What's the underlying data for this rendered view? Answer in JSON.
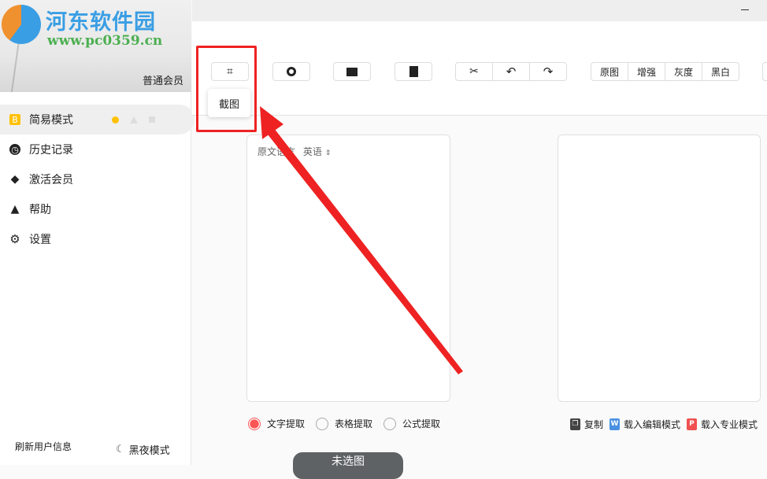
{
  "sidebar": {
    "logo_text": "河东软件园",
    "logo_url": "www.pc0359.cn",
    "member_level": "普通会员",
    "items": [
      {
        "label": "简易模式",
        "icon": "b-icon"
      },
      {
        "label": "历史记录",
        "icon": "clock-icon"
      },
      {
        "label": "激活会员",
        "icon": "diamond-icon"
      },
      {
        "label": "帮助",
        "icon": "warning-help-icon"
      },
      {
        "label": "设置",
        "icon": "gear-icon"
      }
    ],
    "refresh_label": "刷新用户信息",
    "dark_mode_label": "黑夜模式"
  },
  "toolbar": {
    "crop_tooltip": "截图",
    "filters": [
      "原图",
      "增强",
      "灰度",
      "黑白"
    ]
  },
  "left_panel": {
    "lang_label": "原文语言",
    "lang_value": "英语"
  },
  "modes": [
    "文字提取",
    "表格提取",
    "公式提取"
  ],
  "actions": {
    "copy": "复制",
    "word": "载入编辑模式",
    "pro": "载入专业模式",
    "word_badge": "W",
    "pro_badge": "P"
  },
  "submit_label": "未选图",
  "colors": {
    "accent": "#ff5555",
    "annotation": "#ee2222",
    "active_dot": "#ffc107"
  }
}
